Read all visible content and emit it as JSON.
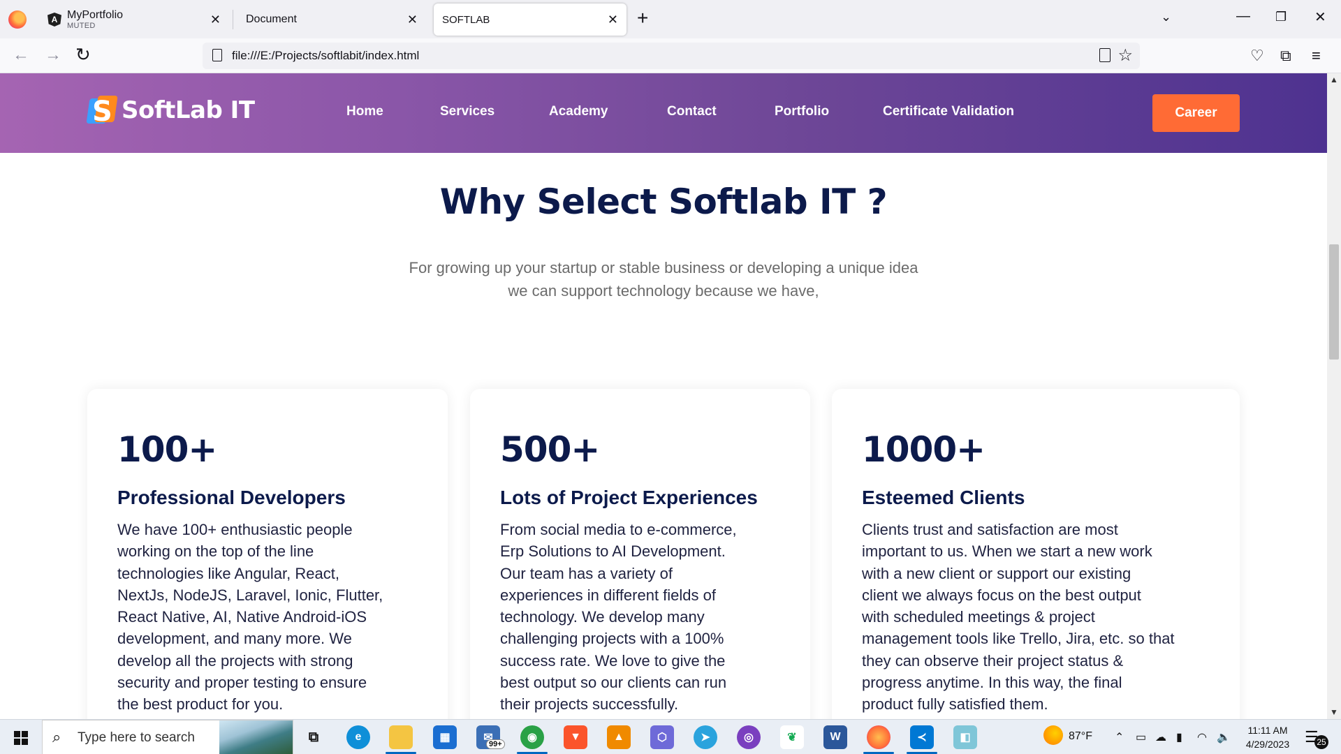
{
  "browser": {
    "tabs": [
      {
        "title": "MyPortfolio",
        "subtitle": "MUTED"
      },
      {
        "title": "Document"
      },
      {
        "title": "SOFTLAB"
      }
    ],
    "url": "file:///E:/Projects/softlabit/index.html",
    "colors": {
      "tabbar": "#f0f0f4",
      "active_tab": "#ffffff"
    }
  },
  "site": {
    "brand": "SoftLab IT",
    "nav": [
      "Home",
      "Services",
      "Academy",
      "Contact",
      "Portfolio",
      "Certificate Validation"
    ],
    "career_label": "Career",
    "colors": {
      "header_start": "#a564b2",
      "header_end": "#4e3290",
      "career_button": "#ff6b35",
      "heading": "#0c1a4b"
    }
  },
  "section": {
    "title": "Why Select Softlab IT ?",
    "subtitle_line1": "For growing up your startup or stable business or developing a unique idea",
    "subtitle_line2": "we can support technology because we have,"
  },
  "cards": [
    {
      "count": "100+",
      "title": "Professional Developers",
      "lines": [
        "We have 100+ enthusiastic people",
        "working on the top of the line",
        "technologies like Angular, React,",
        "NextJs, NodeJS, Laravel, Ionic, Flutter,",
        "React Native, AI, Native Android-iOS",
        "development, and many more. We",
        "develop all the projects with strong",
        "security and proper testing to ensure",
        "the best product for you."
      ]
    },
    {
      "count": "500+",
      "title": "Lots of Project Experiences",
      "lines": [
        "From social media to e-commerce,",
        "Erp Solutions to AI Development.",
        "Our team has a variety of",
        "experiences in different fields of",
        "technology. We develop many",
        "challenging projects with a 100%",
        "success rate. We love to give the",
        "best output so our clients can run",
        "their projects successfully."
      ]
    },
    {
      "count": "1000+",
      "title": "Esteemed Clients",
      "lines": [
        "Clients trust and satisfaction are most",
        "important to us. When we start a new work",
        "with a new client or support our existing",
        "client we always focus on the best output",
        "with scheduled meetings & project",
        "management tools like Trello, Jira, etc. so that",
        "they can observe their project status &",
        "progress anytime. In this way, the final",
        "product fully satisfied them."
      ]
    }
  ],
  "taskbar": {
    "search_placeholder": "Type here to search",
    "mail_badge": "99+",
    "weather": "87°F",
    "time": "11:11 AM",
    "date": "4/29/2023",
    "notifications": "25"
  }
}
